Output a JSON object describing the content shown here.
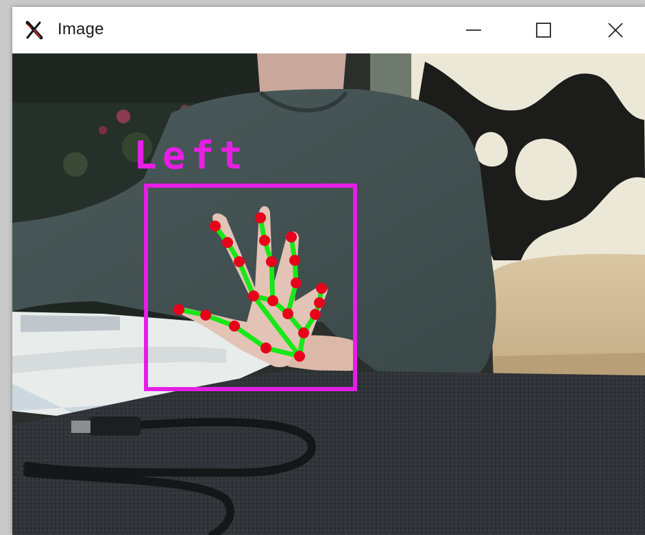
{
  "window": {
    "title": "Image",
    "controls": {
      "minimize_icon": "minimize-icon",
      "maximize_icon": "maximize-icon",
      "close_icon": "close-icon"
    }
  },
  "detection": {
    "label": "Left",
    "box_color": "#e61ee6",
    "landmark_color": "#e8001a",
    "connection_color": "#17e817"
  }
}
